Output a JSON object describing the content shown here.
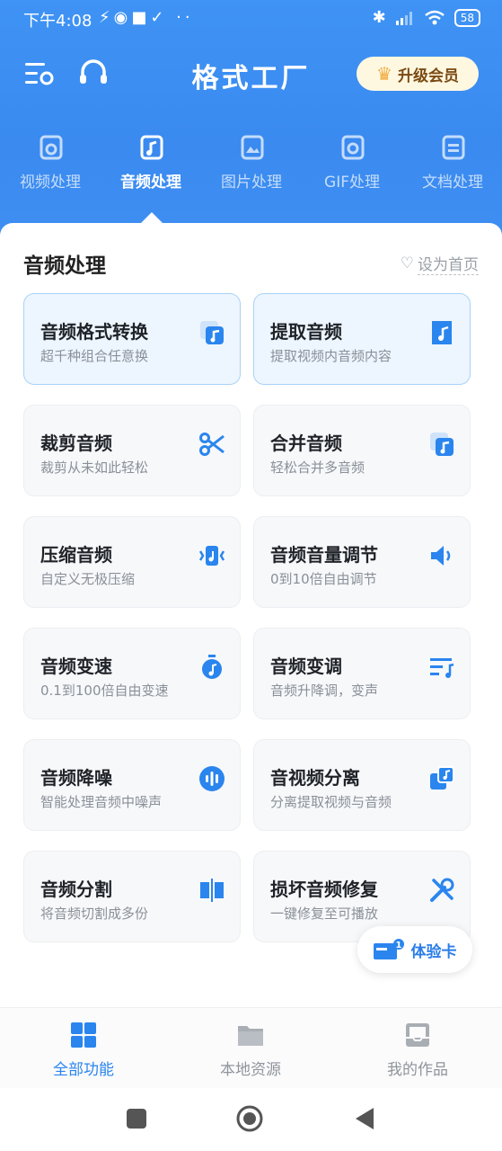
{
  "status_bar": {
    "time": "下午4:08",
    "notification_icons": "⚡◉■✓ ··",
    "battery": "58"
  },
  "header": {
    "title": "格式工厂",
    "vip_label": "升级会员"
  },
  "tabs": [
    {
      "label": "视频处理",
      "icon": "video-icon"
    },
    {
      "label": "音频处理",
      "icon": "audio-icon",
      "active": true
    },
    {
      "label": "图片处理",
      "icon": "image-icon"
    },
    {
      "label": "GIF处理",
      "icon": "gif-icon"
    },
    {
      "label": "文档处理",
      "icon": "document-icon"
    }
  ],
  "section": {
    "title": "音频处理",
    "set_home": "设为首页"
  },
  "cards": [
    {
      "title": "音频格式转换",
      "subtitle": "超千种组合任意换",
      "icon": "audio-convert-icon"
    },
    {
      "title": "提取音频",
      "subtitle": "提取视频内音频内容",
      "icon": "extract-audio-icon"
    },
    {
      "title": "裁剪音频",
      "subtitle": "裁剪从未如此轻松",
      "icon": "scissors-icon"
    },
    {
      "title": "合并音频",
      "subtitle": "轻松合并多音频",
      "icon": "merge-icon"
    },
    {
      "title": "压缩音频",
      "subtitle": "自定义无极压缩",
      "icon": "compress-icon"
    },
    {
      "title": "音频音量调节",
      "subtitle": "0到10倍自由调节",
      "icon": "volume-icon"
    },
    {
      "title": "音频变速",
      "subtitle": "0.1到100倍自由变速",
      "icon": "stopwatch-icon"
    },
    {
      "title": "音频变调",
      "subtitle": "音频升降调，变声",
      "icon": "pitch-icon"
    },
    {
      "title": "音频降噪",
      "subtitle": "智能处理音频中噪声",
      "icon": "denoise-icon"
    },
    {
      "title": "音视频分离",
      "subtitle": "分离提取视频与音频",
      "icon": "separate-icon"
    },
    {
      "title": "音频分割",
      "subtitle": "将音频切割成多份",
      "icon": "split-icon"
    },
    {
      "title": "损坏音频修复",
      "subtitle": "一键修复至可播放",
      "icon": "repair-icon"
    }
  ],
  "trial_card": {
    "label": "体验卡",
    "badge": "1"
  },
  "bottom_nav": [
    {
      "label": "全部功能",
      "icon": "grid-icon",
      "active": true
    },
    {
      "label": "本地资源",
      "icon": "folder-icon"
    },
    {
      "label": "我的作品",
      "icon": "inbox-icon"
    }
  ],
  "colors": {
    "header_blue": "#3a8af0",
    "accent_blue": "#2a85ee",
    "card_highlight": "#edf5fe",
    "vip_bg": "#fff8e1"
  }
}
